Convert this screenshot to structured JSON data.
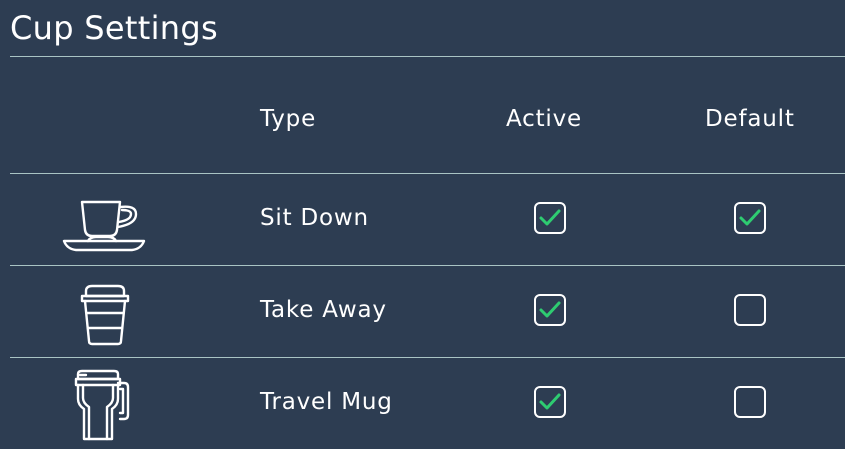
{
  "title": "Cup Settings",
  "columns": {
    "type": "Type",
    "active": "Active",
    "default": "Default"
  },
  "rows": [
    {
      "icon": "cup-and-saucer-icon",
      "label": "Sit Down",
      "active": true,
      "default": true
    },
    {
      "icon": "takeaway-cup-icon",
      "label": "Take Away",
      "active": true,
      "default": false
    },
    {
      "icon": "travel-mug-icon",
      "label": "Travel Mug",
      "active": true,
      "default": false
    }
  ],
  "colors": {
    "background": "#2d3d52",
    "divider": "#a9c4c4",
    "check": "#2ecc71"
  }
}
